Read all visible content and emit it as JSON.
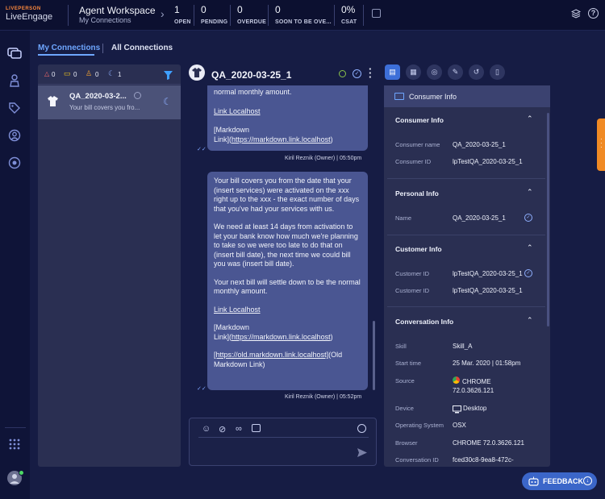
{
  "brand": {
    "company": "LIVEPERSON",
    "product": "LiveEngage"
  },
  "workspace": {
    "title": "Agent Workspace",
    "subtitle": "My Connections"
  },
  "metrics": [
    {
      "value": "1",
      "label": "OPEN"
    },
    {
      "value": "0",
      "label": "PENDING"
    },
    {
      "value": "0",
      "label": "OVERDUE"
    },
    {
      "value": "0",
      "label": "SOON TO BE OVE..."
    },
    {
      "value": "0%",
      "label": "CSAT"
    }
  ],
  "tabs": {
    "my": "My Connections",
    "all": "All Connections"
  },
  "filters": {
    "alert": "0",
    "messages": "0",
    "users": "0",
    "moon": "1"
  },
  "connection": {
    "name": "QA_2020-03-2...",
    "preview": "Your bill covers you fro..."
  },
  "chat": {
    "title": "QA_2020-03-25_1",
    "top_bubble": {
      "line1": "normal monthly amount.",
      "link1": "Link Localhost",
      "md_prefix": "[Markdown",
      "md_line2_prefix": "Link](",
      "md_link": "https://markdown.link.localhost",
      "md_suffix": ")"
    },
    "top_meta": {
      "author": "Kiril Reznik (Owner)",
      "time": "05:50pm"
    },
    "bubble": {
      "p1": "Your bill covers you from the date that your (insert services) were activated on the xxx right up to the xxx - the exact number of days that you've had your services with us.",
      "p2": "We need at least 14 days from activation to let your bank know how much we're planning to take so we were too late to do that on (insert bill date), the next time we could bill you was (insert bill date).",
      "p3": "Your next bill will settle down to be the normal monthly amount.",
      "link1": "Link Localhost",
      "md_prefix": "[Markdown",
      "md_line2_prefix": "Link](",
      "md_link": "https://markdown.link.localhost",
      "md_suffix": ")",
      "old_link": "[https://old.markdown.link.localhost]",
      "old_suffix": "(Old",
      "old_line2": "Markdown Link)"
    },
    "bottom_meta": {
      "author": "Kiril Reznik (Owner)",
      "time": "05:52pm"
    }
  },
  "consumer_panel": {
    "header": "Consumer Info",
    "sections": {
      "consumer": {
        "title": "Consumer Info",
        "name_label": "Consumer name",
        "name_value": "QA_2020-03-25_1",
        "id_label": "Consumer ID",
        "id_value": "lpTestQA_2020-03-25_1"
      },
      "personal": {
        "title": "Personal Info",
        "name_label": "Name",
        "name_value": "QA_2020-03-25_1"
      },
      "customer": {
        "title": "Customer Info",
        "id1_label": "Customer ID",
        "id1_value": "lpTestQA_2020-03-25_1",
        "id2_label": "Customer ID",
        "id2_value": "lpTestQA_2020-03-25_1"
      },
      "conversation": {
        "title": "Conversation Info",
        "skill_label": "Skill",
        "skill_value": "Skill_A",
        "start_label": "Start time",
        "start_value": "25 Mar. 2020 | 01:58pm",
        "source_label": "Source",
        "source_value_1": "CHROME",
        "source_value_2": "72.0.3626.121",
        "device_label": "Device",
        "device_value": "Desktop",
        "os_label": "Operating System",
        "os_value": "OSX",
        "browser_label": "Browser",
        "browser_value": "CHROME 72.0.3626.121",
        "conv_id_label": "Conversation ID",
        "conv_id_value": "fced30c8-9ea8-472c-"
      }
    }
  },
  "feedback": "FEEDBACK",
  "colors": {
    "accent": "#3b66c9",
    "orange": "#f08a24",
    "background": "#161c44"
  }
}
